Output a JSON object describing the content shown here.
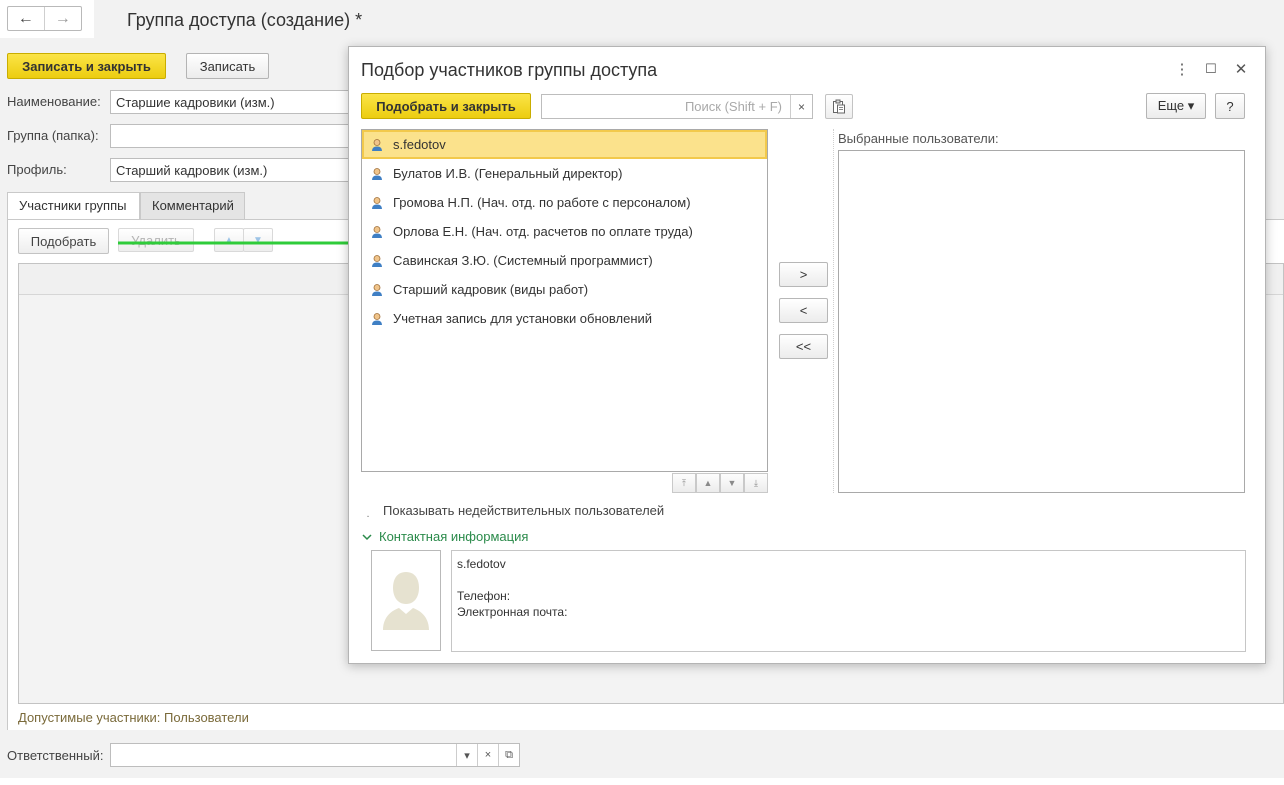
{
  "form": {
    "title": "Группа доступа (создание) *",
    "nav": {
      "back_icon": "←",
      "forward_icon": "→"
    },
    "buttons": {
      "save_close": "Записать и закрыть",
      "save": "Записать"
    },
    "fields": {
      "name_label": "Наименование:",
      "name_value": "Старшие кадровики (изм.)",
      "group_label": "Группа (папка):",
      "group_value": "",
      "profile_label": "Профиль:",
      "profile_value": "Старший кадровик (изм.)"
    },
    "tabs": [
      {
        "label": "Участники группы",
        "active": true
      },
      {
        "label": "Комментарий",
        "active": false
      }
    ],
    "members_toolbar": {
      "pick": "Подобрать",
      "delete": "Удалить",
      "up_icon": "▲",
      "down_icon": "▼"
    },
    "allowed_members": "Допустимые участники: Пользователи",
    "responsible_label": "Ответственный:",
    "responsible_value": "",
    "responsible_buttons": {
      "dropdown": "▾",
      "clear": "×",
      "open": "⧉"
    }
  },
  "dialog": {
    "title": "Подбор участников группы доступа",
    "window_controls": {
      "more": "⋮",
      "maximize": "☐",
      "close": "✕"
    },
    "pick_close": "Подобрать и закрыть",
    "search": {
      "placeholder": "Поиск (Shift + F)",
      "value": "",
      "clear": "×"
    },
    "paste_icon": "clipboard-icon",
    "more": "Еще ▾",
    "help": "?",
    "users": [
      {
        "name": "s.fedotov",
        "selected": true
      },
      {
        "name": "Булатов И.В. (Генеральный директор)",
        "selected": false
      },
      {
        "name": "Громова Н.П. (Нач. отд. по работе с персоналом)",
        "selected": false
      },
      {
        "name": "Орлова Е.Н. (Нач. отд. расчетов по оплате труда)",
        "selected": false
      },
      {
        "name": "Савинская З.Ю. (Системный программист)",
        "selected": false
      },
      {
        "name": "Старший кадровик (виды работ)",
        "selected": false
      },
      {
        "name": "Учетная запись для установки обновлений",
        "selected": false
      }
    ],
    "list_nav": {
      "first": "⤒",
      "up": "▲",
      "down": "▼",
      "last": "⤓"
    },
    "move": {
      "add": ">",
      "remove": "<",
      "remove_all": "<<"
    },
    "selected_users_label": "Выбранные пользователи:",
    "show_invalid_label": "Показывать недействительных пользователей",
    "contact_info_label": "Контактная информация",
    "contact": {
      "login": "s.fedotov",
      "phone_label": "Телефон:",
      "email_label": "Электронная почта:"
    },
    "colors": {
      "accent_yellow": "#f5d81f",
      "selected_row": "#fbe28c",
      "green_arrow": "#2fcc3a",
      "contact_green": "#2a8a4a"
    }
  }
}
